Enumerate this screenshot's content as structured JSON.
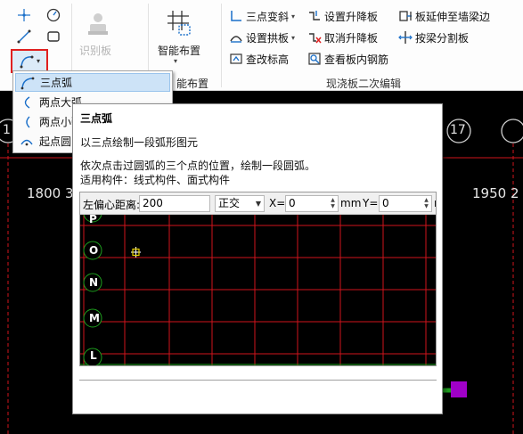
{
  "ribbon": {
    "identify_board_label": "识别板",
    "smart_layout_label": "智能布置",
    "smart_layout_group_partial": "能布置",
    "group_title": "现浇板二次编辑",
    "items": {
      "three_point_slope": "三点变斜",
      "set_lift_board": "设置升降板",
      "board_extend": "板延伸至墙梁边",
      "set_arch_board": "设置拱板",
      "cancel_lift_board": "取消升降板",
      "split_by_beam": "按梁分割板",
      "change_elevation": "查改标高",
      "view_rebar": "查看板内钢筋"
    }
  },
  "menu": {
    "items": [
      {
        "label": "三点弧"
      },
      {
        "label": "两点大弧"
      },
      {
        "label": "两点小弧"
      },
      {
        "label": "起点圆"
      }
    ]
  },
  "canvas": {
    "axis_left": "1",
    "axis_right": "17",
    "dim_left": "1800 3",
    "dim_right": "1950 2"
  },
  "tooltip": {
    "title": "三点弧",
    "subtitle": "以三点绘制一段弧形图元",
    "desc_line1": "依次点击过圆弧的三个点的位置，绘制一段圆弧。",
    "desc_line2": "适用构件：线式构件、面式构件",
    "toolbar": {
      "left_offset_label": "左偏心距离:",
      "left_offset_value": "200",
      "mode_value": "正交",
      "x_label": "X=",
      "x_value": "0",
      "mm_label": "mm",
      "y_label": "Y=",
      "y_value": "0",
      "trailing_partial": "r"
    },
    "grid_axes": [
      "P",
      "O",
      "N",
      "M",
      "L"
    ]
  },
  "colors": {
    "grid_line": "#d0141c",
    "axis_circle": "#1ea01e",
    "highlight_box": "#e02020",
    "menu_selected": "#cde3f7",
    "accent_icon": "#1a6fc9",
    "magenta_marker": "#a000c8"
  }
}
